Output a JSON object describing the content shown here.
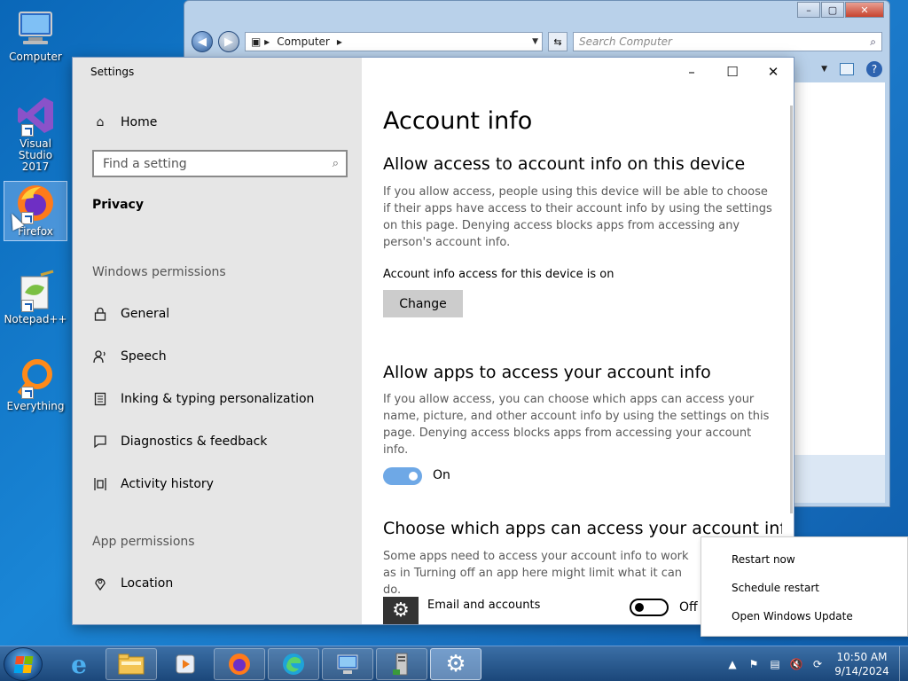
{
  "desktop": {
    "icons": [
      {
        "label": "Computer",
        "icon": "computer-icon"
      },
      {
        "label": "Visual Studio 2017",
        "icon": "visual-studio-icon"
      },
      {
        "label": "Firefox",
        "icon": "firefox-icon"
      },
      {
        "label": "Notepad++",
        "icon": "notepadpp-icon"
      },
      {
        "label": "Everything",
        "icon": "everything-icon"
      }
    ]
  },
  "explorer": {
    "address": "Computer",
    "search_placeholder": "Search Computer"
  },
  "settings": {
    "title": "Settings",
    "sidebar": {
      "home": "Home",
      "search_placeholder": "Find a setting",
      "section": "Privacy",
      "windows_permissions_heading": "Windows permissions",
      "items": [
        {
          "label": "General",
          "icon": "lock-icon"
        },
        {
          "label": "Speech",
          "icon": "speech-icon"
        },
        {
          "label": "Inking & typing personalization",
          "icon": "inking-icon"
        },
        {
          "label": "Diagnostics & feedback",
          "icon": "feedback-icon"
        },
        {
          "label": "Activity history",
          "icon": "activity-icon"
        }
      ],
      "app_permissions_heading": "App permissions",
      "app_items": [
        {
          "label": "Location",
          "icon": "location-icon"
        }
      ]
    },
    "content": {
      "page_title": "Account info",
      "section1_title": "Allow access to account info on this device",
      "section1_desc": "If you allow access, people using this device will be able to choose if their apps have access to their account info by using the settings on this page. Denying access blocks apps from accessing any person's account info.",
      "section1_status": "Account info access for this device is on",
      "change_button": "Change",
      "section2_title": "Allow apps to access your account info",
      "section2_desc": "If you allow access, you can choose which apps can access your name, picture, and other account info by using the settings on this page. Denying access blocks apps from accessing your account info.",
      "section2_toggle_label": "On",
      "section3_title": "Choose which apps can access your account info",
      "section3_desc": "Some apps need to access your account info to work as in Turning off an app here might limit what it can do.",
      "apps": [
        {
          "name": "Email and accounts",
          "toggle_label": "Off",
          "icon": "gear-icon"
        }
      ]
    }
  },
  "context_menu": {
    "items": [
      "Restart now",
      "Schedule restart",
      "Open Windows Update"
    ]
  },
  "taskbar": {
    "clock_time": "10:50 AM",
    "clock_date": "9/14/2024"
  }
}
